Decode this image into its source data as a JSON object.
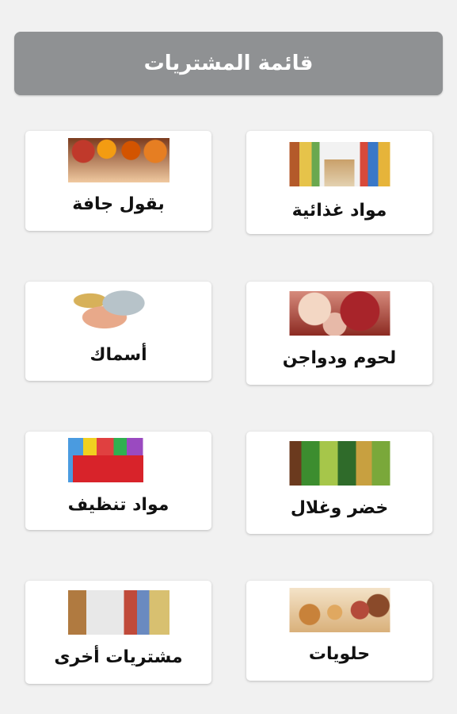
{
  "header": {
    "title": "قائمة المشتريات"
  },
  "categories": [
    {
      "label": "مواد غذائية",
      "image_icon": "supermarket-aisle-image"
    },
    {
      "label": "بقول جافة",
      "image_icon": "spices-image"
    },
    {
      "label": "لحوم ودواجن",
      "image_icon": "meat-poultry-image"
    },
    {
      "label": "أسماك",
      "image_icon": "fish-image"
    },
    {
      "label": "خضر وغلال",
      "image_icon": "vegetables-fruits-image"
    },
    {
      "label": "مواد تنظيف",
      "image_icon": "cleaning-products-image"
    },
    {
      "label": "حلويات",
      "image_icon": "sweets-image"
    },
    {
      "label": "مشتريات أخرى",
      "image_icon": "other-purchases-image"
    }
  ],
  "colors": {
    "header_bg": "#8f9193",
    "page_bg": "#f1f1f1",
    "card_bg": "#ffffff"
  }
}
